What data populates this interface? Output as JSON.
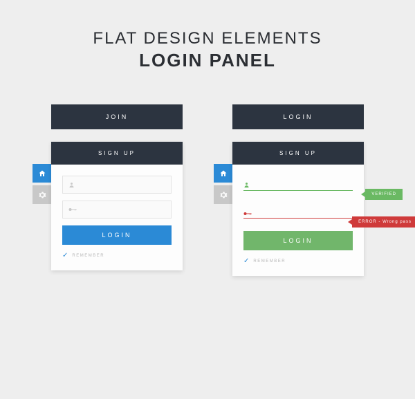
{
  "header": {
    "line1": "FLAT DESIGN ELEMENTS",
    "line2": "LOGIN PANEL"
  },
  "panelLeft": {
    "topButton": "JOIN",
    "cardHeader": "SIGN UP",
    "loginButton": "LOGIN",
    "remember": "REMEMBER"
  },
  "panelRight": {
    "topButton": "LOGIN",
    "cardHeader": "SIGN UP",
    "loginButton": "LOGIN",
    "remember": "REMEMBER",
    "verifiedBadge": "VERIFIED",
    "errorBadge": "ERROR - Wrong pass"
  }
}
